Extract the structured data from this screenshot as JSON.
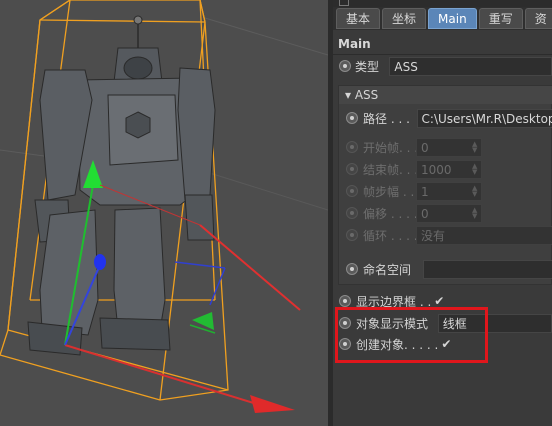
{
  "tabs": [
    {
      "label": "基本",
      "active": false
    },
    {
      "label": "坐标",
      "active": false
    },
    {
      "label": "Main",
      "active": true
    },
    {
      "label": "重写",
      "active": false
    },
    {
      "label": "资",
      "active": false
    }
  ],
  "section_title": "Main",
  "type_row": {
    "label": "类型",
    "value": "ASS"
  },
  "ass_group": {
    "header": "▾ ASS",
    "path": {
      "label": "路径 . . .",
      "value": "C:\\Users\\Mr.R\\Desktop\\ro"
    },
    "start_frame": {
      "label": "开始帧. . .",
      "value": "0"
    },
    "end_frame": {
      "label": "结束帧. . .",
      "value": "1000"
    },
    "frame_step": {
      "label": "帧步幅 . .",
      "value": "1"
    },
    "offset": {
      "label": "偏移 . . . .",
      "value": "0"
    },
    "cycle": {
      "label": "循环 . . . .",
      "value": "没有"
    },
    "namespace": {
      "label": "命名空间",
      "value": ""
    }
  },
  "show_bbox": {
    "label": "显示边界框 . .",
    "check": "✔"
  },
  "display_mode": {
    "label": "对象显示模式",
    "value": "线框"
  },
  "create_object": {
    "label": "创建对象. . . . .",
    "check": "✔"
  },
  "colors": {
    "active_tab": "#5b86b8",
    "highlight_box": "#e0161c",
    "bbox": "#f0a020"
  }
}
